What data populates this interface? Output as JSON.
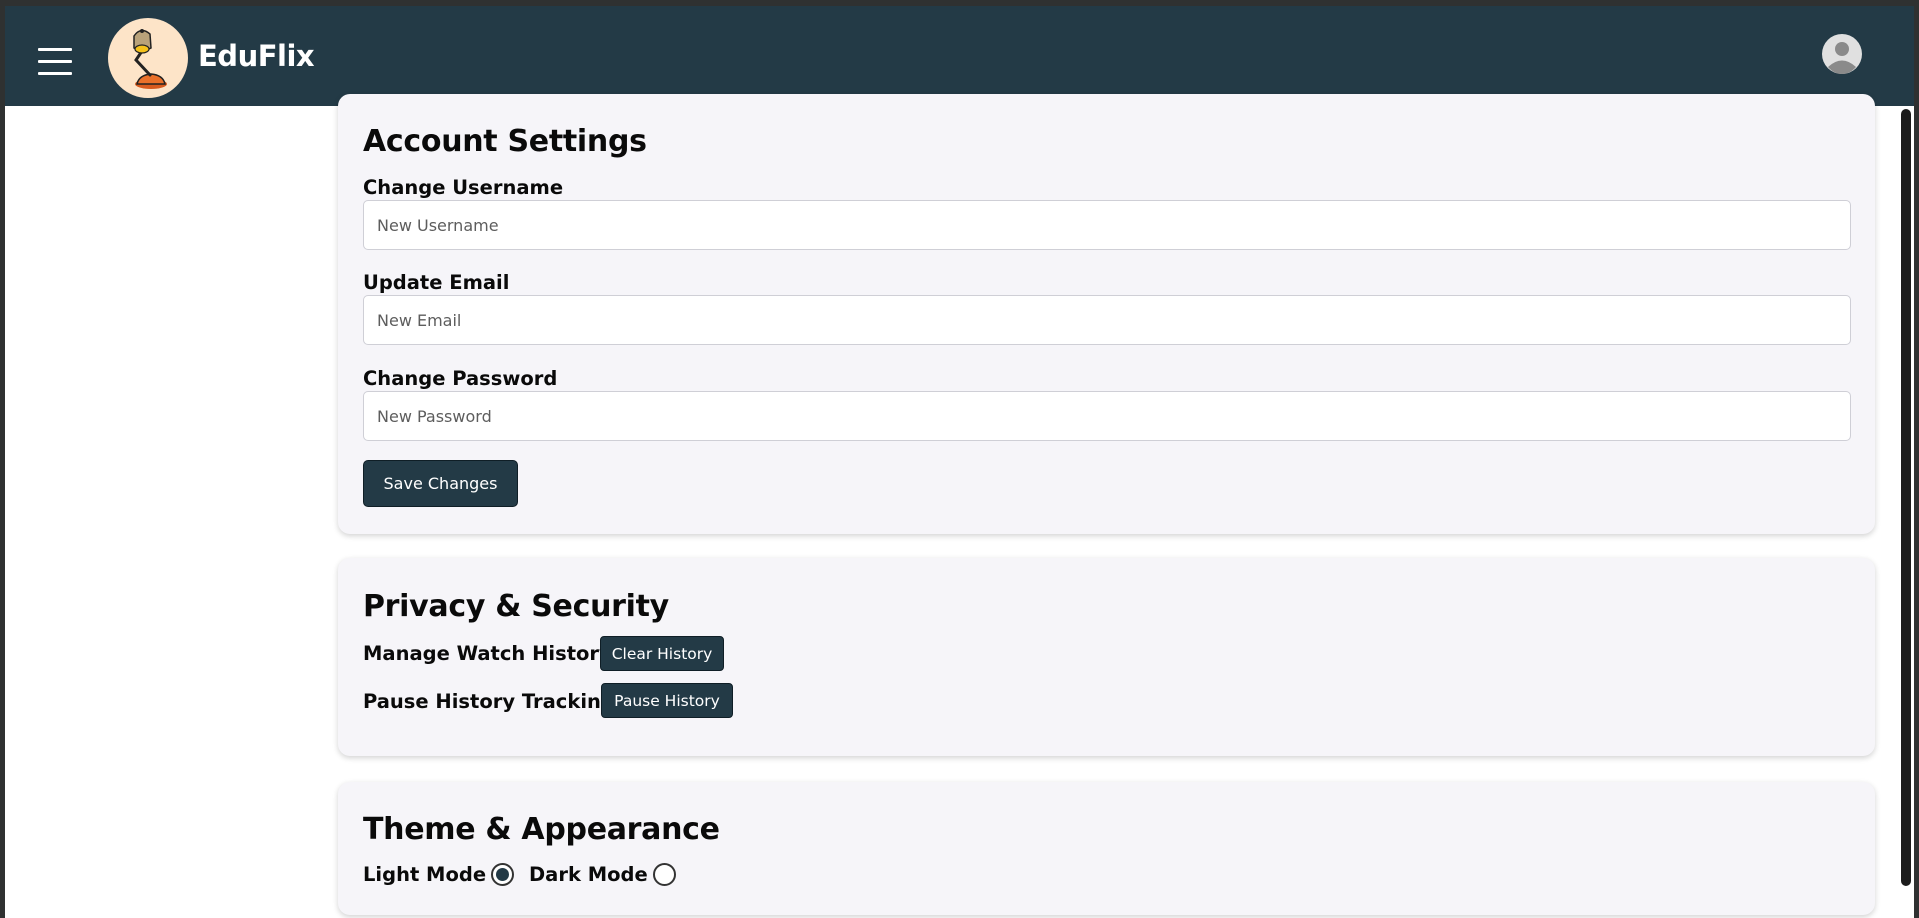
{
  "header": {
    "brand": "EduFlix",
    "menu_icon": "hamburger-icon",
    "logo_icon": "desk-lamp-icon",
    "avatar_icon": "user-avatar-icon",
    "background": "#233a46"
  },
  "account": {
    "title": "Account Settings",
    "username_label": "Change Username",
    "username_placeholder": "New Username",
    "email_label": "Update Email",
    "email_placeholder": "New Email",
    "password_label": "Change Password",
    "password_placeholder": "New Password",
    "save_label": "Save Changes"
  },
  "privacy": {
    "title": "Privacy & Security",
    "watch_history_label": "Manage Watch History",
    "clear_history_label": "Clear History",
    "pause_tracking_label": "Pause History Tracking",
    "pause_history_label": "Pause History"
  },
  "theme": {
    "title": "Theme & Appearance",
    "light_label": "Light Mode",
    "dark_label": "Dark Mode",
    "selected": "Light Mode"
  },
  "colors": {
    "accent": "#233a46",
    "card_background": "#f6f5f9"
  }
}
